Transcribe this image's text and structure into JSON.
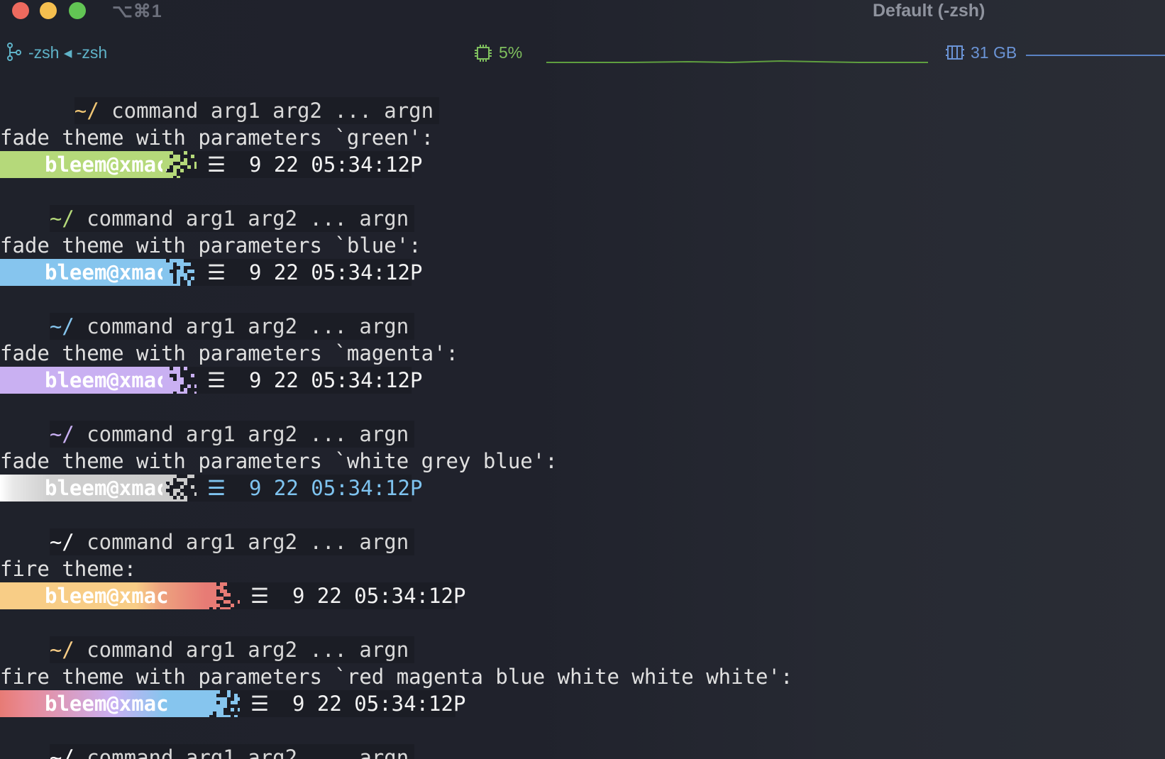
{
  "window": {
    "shortcut": "⌥⌘1",
    "title": "Default (-zsh)"
  },
  "statusbar": {
    "session": "-zsh ◂ -zsh",
    "cpu": "5%",
    "memory": "31 GB",
    "colors": {
      "session": "#5fb3c8",
      "cpu": "#7fbf5e",
      "memory": "#6b94d6"
    }
  },
  "prompt": {
    "tilde": "~/",
    "command": " command arg1 arg2 ... argn",
    "user": "bleem@xmac",
    "menu": "☰",
    "time": "9 22 05:34:12P"
  },
  "blocks": [
    {
      "caption": "fade theme with parameters `green':",
      "user_color": "#b5d97a",
      "tilde_color": "#b5d97a",
      "time_color": "#f2f2f2",
      "style": "fade"
    },
    {
      "caption": "fade theme with parameters `blue':",
      "user_color": "#86c5ee",
      "tilde_color": "#86c5ee",
      "time_color": "#f2f2f2",
      "style": "fade"
    },
    {
      "caption": "fade theme with parameters `magenta':",
      "user_color": "#c9b0f2",
      "tilde_color": "#c9b0f2",
      "time_color": "#f2f2f2",
      "style": "fade"
    },
    {
      "caption": "fade theme with parameters `white grey blue':",
      "user_color": "#d8d8d8",
      "tilde_color": "#ffffff",
      "time_color": "#7ec3ef",
      "style": "white"
    },
    {
      "caption": "fire theme:",
      "user_color": "#f8cd86",
      "tilde_color": "#f8cd86",
      "time_color": "#f2f2f2",
      "style": "fire"
    },
    {
      "caption": "fire theme with parameters `red magenta blue white white white':",
      "user_color": "#e77b75",
      "tilde_color": "#ffffff",
      "time_color": "#f2f2f2",
      "style": "fire2"
    }
  ]
}
